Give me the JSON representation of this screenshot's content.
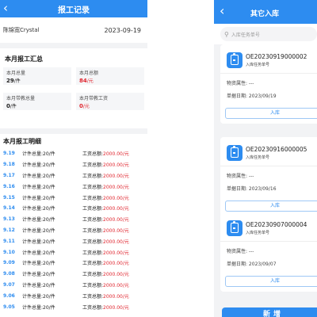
{
  "left": {
    "back_icon": "chevron-left-icon",
    "title": "报工记录",
    "user": "陈锦宽Crystal",
    "date": "2023-09-19",
    "summary": {
      "title": "本月报工汇总",
      "stats": [
        {
          "label": "本月总量",
          "value": "29",
          "unit": "/件",
          "color": "#222222"
        },
        {
          "label": "本月总额",
          "value": "84",
          "unit": "/元",
          "color": "#e0262f"
        },
        {
          "label": "本月带教总量",
          "value": "0",
          "unit": "/件",
          "color": "#222222"
        },
        {
          "label": "本月带教工资",
          "value": "0",
          "unit": "/元",
          "color": "#e0262f"
        }
      ]
    },
    "detail": {
      "title": "本月报工明细",
      "rows": [
        {
          "date": "9.19",
          "qty": "计件总量:20/件",
          "wage_label": "工资总额:",
          "wage": "2000.00/元"
        },
        {
          "date": "9.18",
          "qty": "计件总量:20/件",
          "wage_label": "工资总额:",
          "wage": "2000.00/元"
        },
        {
          "date": "9.17",
          "qty": "计件总量:20/件",
          "wage_label": "工资总额:",
          "wage": "2000.00/元"
        },
        {
          "date": "9.16",
          "qty": "计件总量:20/件",
          "wage_label": "工资总额:",
          "wage": "2000.00/元"
        },
        {
          "date": "9.15",
          "qty": "计件总量:20/件",
          "wage_label": "工资总额:",
          "wage": "2000.00/元"
        },
        {
          "date": "9.14",
          "qty": "计件总量:20/件",
          "wage_label": "工资总额:",
          "wage": "2000.00/元"
        },
        {
          "date": "9.13",
          "qty": "计件总量:20/件",
          "wage_label": "工资总额:",
          "wage": "2000.00/元"
        },
        {
          "date": "9.12",
          "qty": "计件总量:20/件",
          "wage_label": "工资总额:",
          "wage": "2000.00/元"
        },
        {
          "date": "9.11",
          "qty": "计件总量:20/件",
          "wage_label": "工资总额:",
          "wage": "2000.00/元"
        },
        {
          "date": "9.10",
          "qty": "计件总量:20/件",
          "wage_label": "工资总额:",
          "wage": "2000.00/元"
        },
        {
          "date": "9.09",
          "qty": "计件总量:20/件",
          "wage_label": "工资总额:",
          "wage": "2000.00/元"
        },
        {
          "date": "9.08",
          "qty": "计件总量:20/件",
          "wage_label": "工资总额:",
          "wage": "2000.00/元"
        },
        {
          "date": "9.07",
          "qty": "计件总量:20/件",
          "wage_label": "工资总额:",
          "wage": "2000.00/元"
        },
        {
          "date": "9.06",
          "qty": "计件总量:20/件",
          "wage_label": "工资总额:",
          "wage": "2000.00/元"
        },
        {
          "date": "9.05",
          "qty": "计件总量:20/件",
          "wage_label": "工资总额:",
          "wage": "2000.00/元"
        }
      ]
    }
  },
  "right": {
    "back_icon": "chevron-left-icon",
    "title": "其它入库",
    "search_icon": "search-icon",
    "search_placeholder": "入库任务单号",
    "cards": [
      {
        "code": "OE20230919000002",
        "type": "入库任务单号",
        "field1": "物资属性:  ---",
        "field2": "单据日期:  2023/09/19",
        "button": "入库",
        "icon": "clipboard-icon"
      },
      {
        "code": "OE20230916000005",
        "type": "入库任务单号",
        "field1": "物资属性:  ---",
        "field2": "单据日期:  2023/09/16",
        "button": "入库",
        "icon": "clipboard-icon"
      },
      {
        "code": "OE20230907000004",
        "type": "入库任务单号",
        "field1": "物资属性:  ---",
        "field2": "单据日期:  2023/09/07",
        "button": "入库",
        "icon": "clipboard-icon"
      }
    ],
    "new_button": "新增"
  },
  "colors": {
    "accent": "#2d8cf0",
    "danger": "#e0262f",
    "background": "#f2f3f5"
  }
}
